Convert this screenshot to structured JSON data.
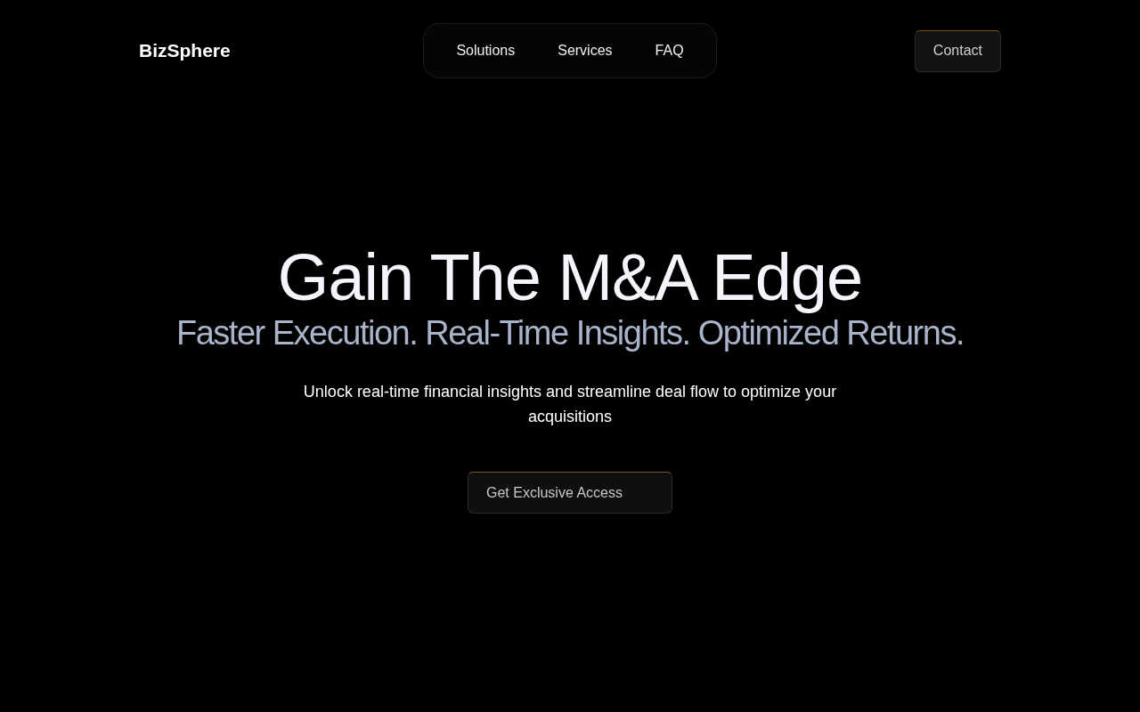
{
  "brand": "BizSphere",
  "nav": [
    "Solutions",
    "Services",
    "FAQ"
  ],
  "contact_button": "Contact",
  "hero": {
    "title": "Gain The M&A Edge",
    "subtitle": "Faster Execution. Real-Time Insights. Optimized Returns.",
    "description": "Unlock real-time financial insights and streamline deal flow to optimize your acquisitions",
    "cta": "Get Exclusive Access"
  }
}
